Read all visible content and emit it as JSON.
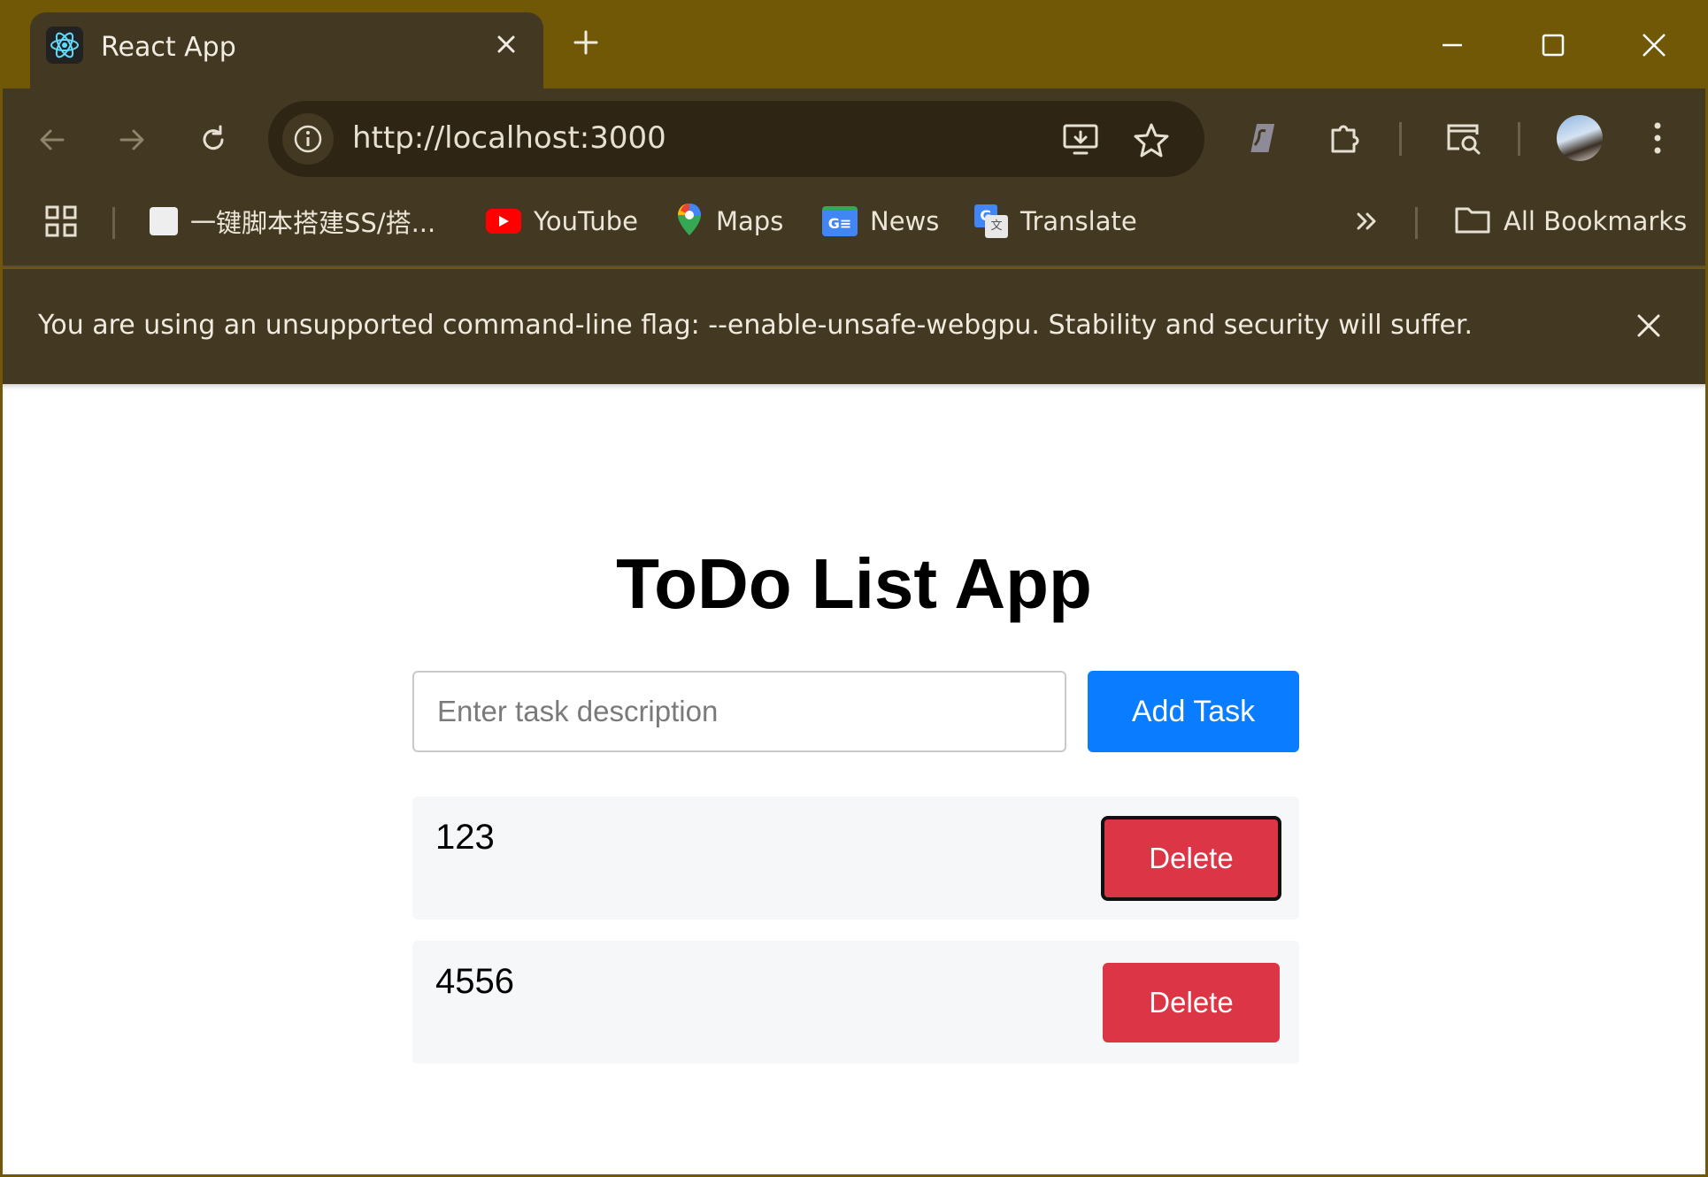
{
  "browser": {
    "tab": {
      "title": "React App",
      "favicon": "react-logo-icon"
    },
    "address_bar": {
      "url": "http://localhost:3000"
    },
    "bookmarks": [
      {
        "label": "一键脚本搭建SS/搭...",
        "icon": "script-icon"
      },
      {
        "label": "YouTube",
        "icon": "youtube-icon"
      },
      {
        "label": "Maps",
        "icon": "maps-pin-icon"
      },
      {
        "label": "News",
        "icon": "news-icon"
      },
      {
        "label": "Translate",
        "icon": "translate-icon"
      }
    ],
    "all_bookmarks_label": "All Bookmarks",
    "infobar_message": "You are using an unsupported command-line flag: --enable-unsafe-webgpu. Stability and security will suffer.",
    "colors": {
      "frame": "#705807",
      "toolbar": "#433821",
      "omnibox": "#2e2514"
    }
  },
  "app": {
    "title": "ToDo List App",
    "input": {
      "placeholder": "Enter task description",
      "value": ""
    },
    "add_button_label": "Add Task",
    "tasks": [
      {
        "text": "123",
        "delete_label": "Delete"
      },
      {
        "text": "4556",
        "delete_label": "Delete"
      }
    ],
    "colors": {
      "primary": "#0a7cff",
      "danger": "#dc3545",
      "row_bg": "#f6f7f9"
    }
  }
}
